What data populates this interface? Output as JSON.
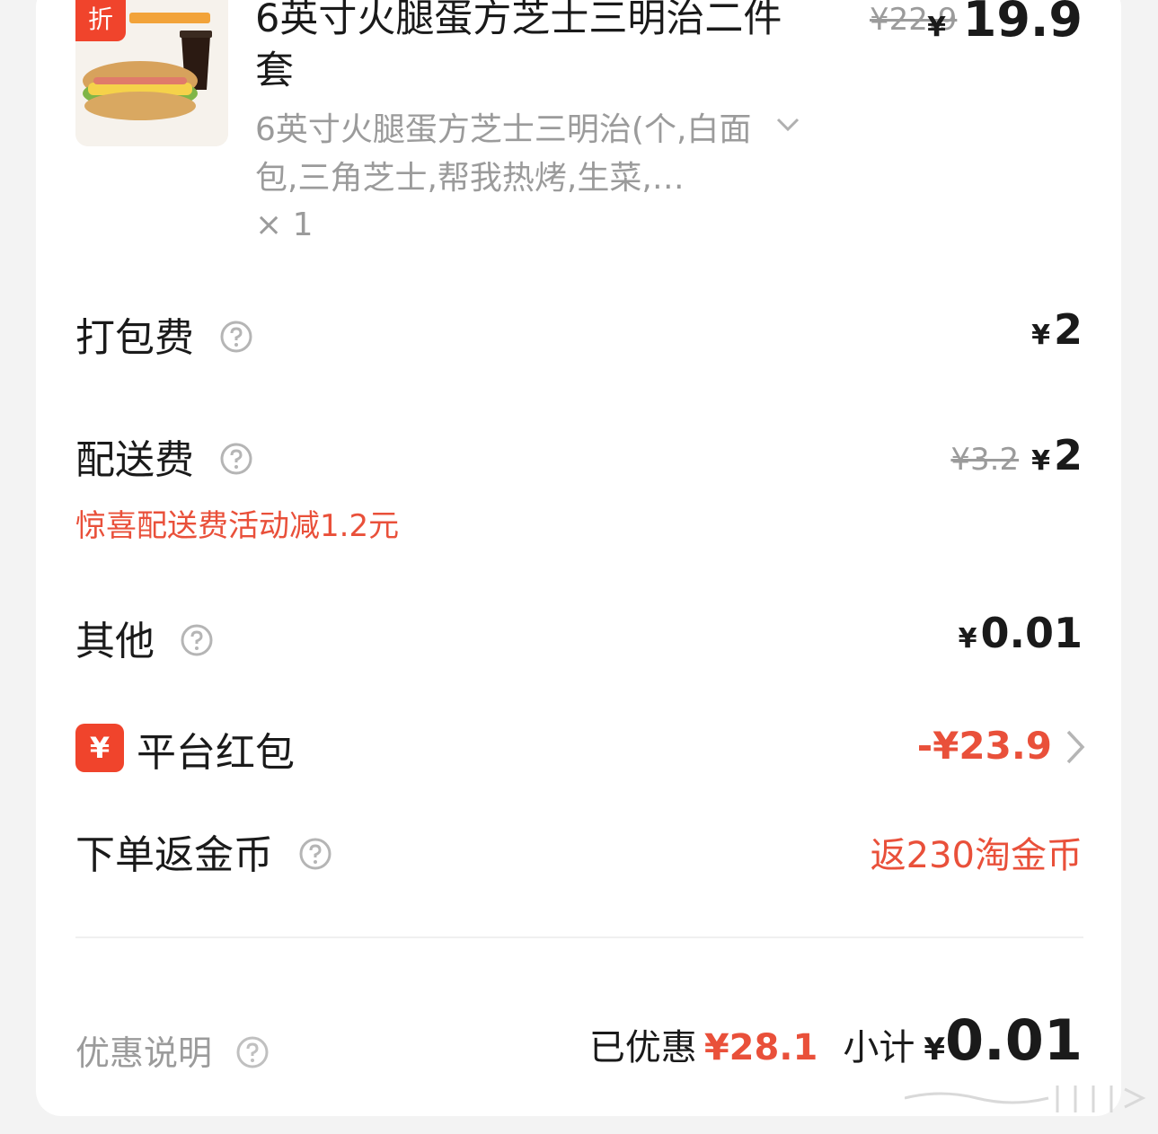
{
  "product": {
    "badge": "折",
    "title": "6英寸火腿蛋方芝士三明治二件套",
    "spec": "6英寸火腿蛋方芝士三明治(个,白面包,三角芝士,帮我热烤,生菜,…",
    "qty": "× 1",
    "original_price": "¥22.9",
    "price_symbol": "¥",
    "price": "19.9",
    "image_icon": "sandwich-combo-icon"
  },
  "fees": {
    "packing": {
      "label": "打包费",
      "symbol": "¥",
      "value": "2"
    },
    "delivery": {
      "label": "配送费",
      "original": "¥3.2",
      "symbol": "¥",
      "value": "2",
      "promo": "惊喜配送费活动减1.2元"
    },
    "other": {
      "label": "其他",
      "symbol": "¥",
      "value": "0.01"
    }
  },
  "red_packet": {
    "icon_char": "¥",
    "label": "平台红包",
    "value": "-¥23.9"
  },
  "coins": {
    "label": "下单返金币",
    "value": "返230淘金币"
  },
  "footer": {
    "discount_label": "优惠说明",
    "saved_label": "已优惠",
    "saved_amount": "¥28.1",
    "subtotal_label": "小计",
    "subtotal_symbol": "¥",
    "subtotal_value": "0.01"
  },
  "colors": {
    "accent": "#e9503a",
    "badge": "#f0442c"
  }
}
